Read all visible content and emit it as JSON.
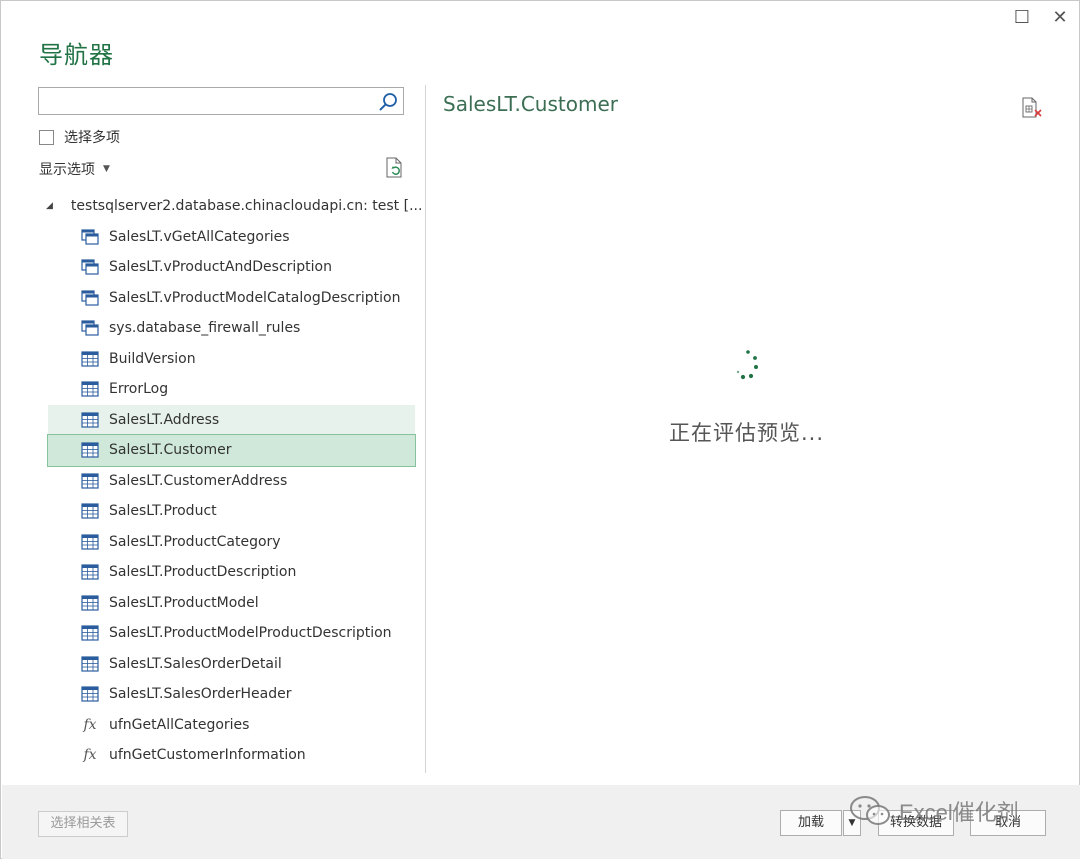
{
  "window": {
    "title": "导航器",
    "maximize_glyph": "☐",
    "close_glyph": "✕"
  },
  "search": {
    "value": "",
    "placeholder": ""
  },
  "select_multiple_label": "选择多项",
  "display_options_label": "显示选项",
  "tree": {
    "root_label": "testsqlserver2.database.chinacloudapi.cn: test [...",
    "items": [
      {
        "label": "SalesLT.vGetAllCategories",
        "icon": "view-icon"
      },
      {
        "label": "SalesLT.vProductAndDescription",
        "icon": "view-icon"
      },
      {
        "label": "SalesLT.vProductModelCatalogDescription",
        "icon": "view-icon"
      },
      {
        "label": "sys.database_firewall_rules",
        "icon": "view-icon"
      },
      {
        "label": "BuildVersion",
        "icon": "table-icon"
      },
      {
        "label": "ErrorLog",
        "icon": "table-icon"
      },
      {
        "label": "SalesLT.Address",
        "icon": "table-icon"
      },
      {
        "label": "SalesLT.Customer",
        "icon": "table-icon"
      },
      {
        "label": "SalesLT.CustomerAddress",
        "icon": "table-icon"
      },
      {
        "label": "SalesLT.Product",
        "icon": "table-icon"
      },
      {
        "label": "SalesLT.ProductCategory",
        "icon": "table-icon"
      },
      {
        "label": "SalesLT.ProductDescription",
        "icon": "table-icon"
      },
      {
        "label": "SalesLT.ProductModel",
        "icon": "table-icon"
      },
      {
        "label": "SalesLT.ProductModelProductDescription",
        "icon": "table-icon"
      },
      {
        "label": "SalesLT.SalesOrderDetail",
        "icon": "table-icon"
      },
      {
        "label": "SalesLT.SalesOrderHeader",
        "icon": "table-icon"
      },
      {
        "label": "ufnGetAllCategories",
        "icon": "function-icon"
      },
      {
        "label": "ufnGetCustomerInformation",
        "icon": "function-icon"
      }
    ]
  },
  "preview": {
    "title": "SalesLT.Customer",
    "status": "正在评估预览..."
  },
  "footer": {
    "select_related_label": "选择相关表",
    "load_label": "加载",
    "transform_label": "转换数据",
    "cancel_label": "取消"
  },
  "watermark": {
    "text": "Excel催化剂"
  },
  "colors": {
    "accent": "#217346",
    "selected_bg": "#cfe8d9",
    "hover_bg": "#e6f2eb"
  }
}
